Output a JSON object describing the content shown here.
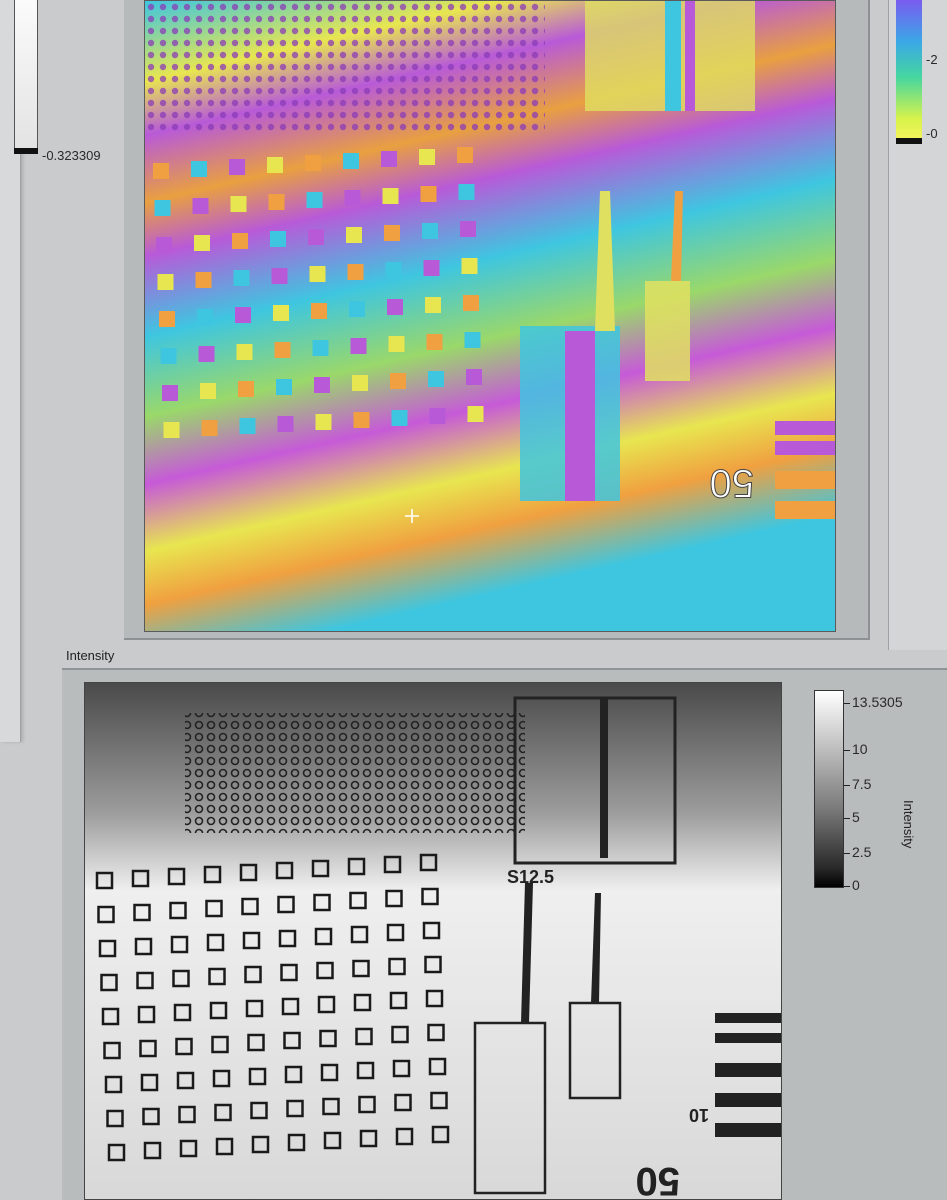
{
  "left_panel": {
    "colorbar_min_label": "-0.323309"
  },
  "phase_view": {
    "scale_text": "50",
    "right_colorbar_labels": [
      "-2",
      "-0"
    ],
    "colors": {
      "purple": "#b85ad8",
      "cyan": "#3ec6e0",
      "yellow": "#e8e650",
      "orange": "#f0a040"
    }
  },
  "intensity_view": {
    "title": "Intensity",
    "colorbar_title": "Intensity",
    "colorbar_ticks": [
      "13.5305",
      "10",
      "7.5",
      "5",
      "2.5",
      "0"
    ],
    "overlay_text": "S12.5",
    "scale_text": "50",
    "side_text": "10"
  },
  "icons": {
    "cursor": "crosshair-cursor-icon"
  }
}
